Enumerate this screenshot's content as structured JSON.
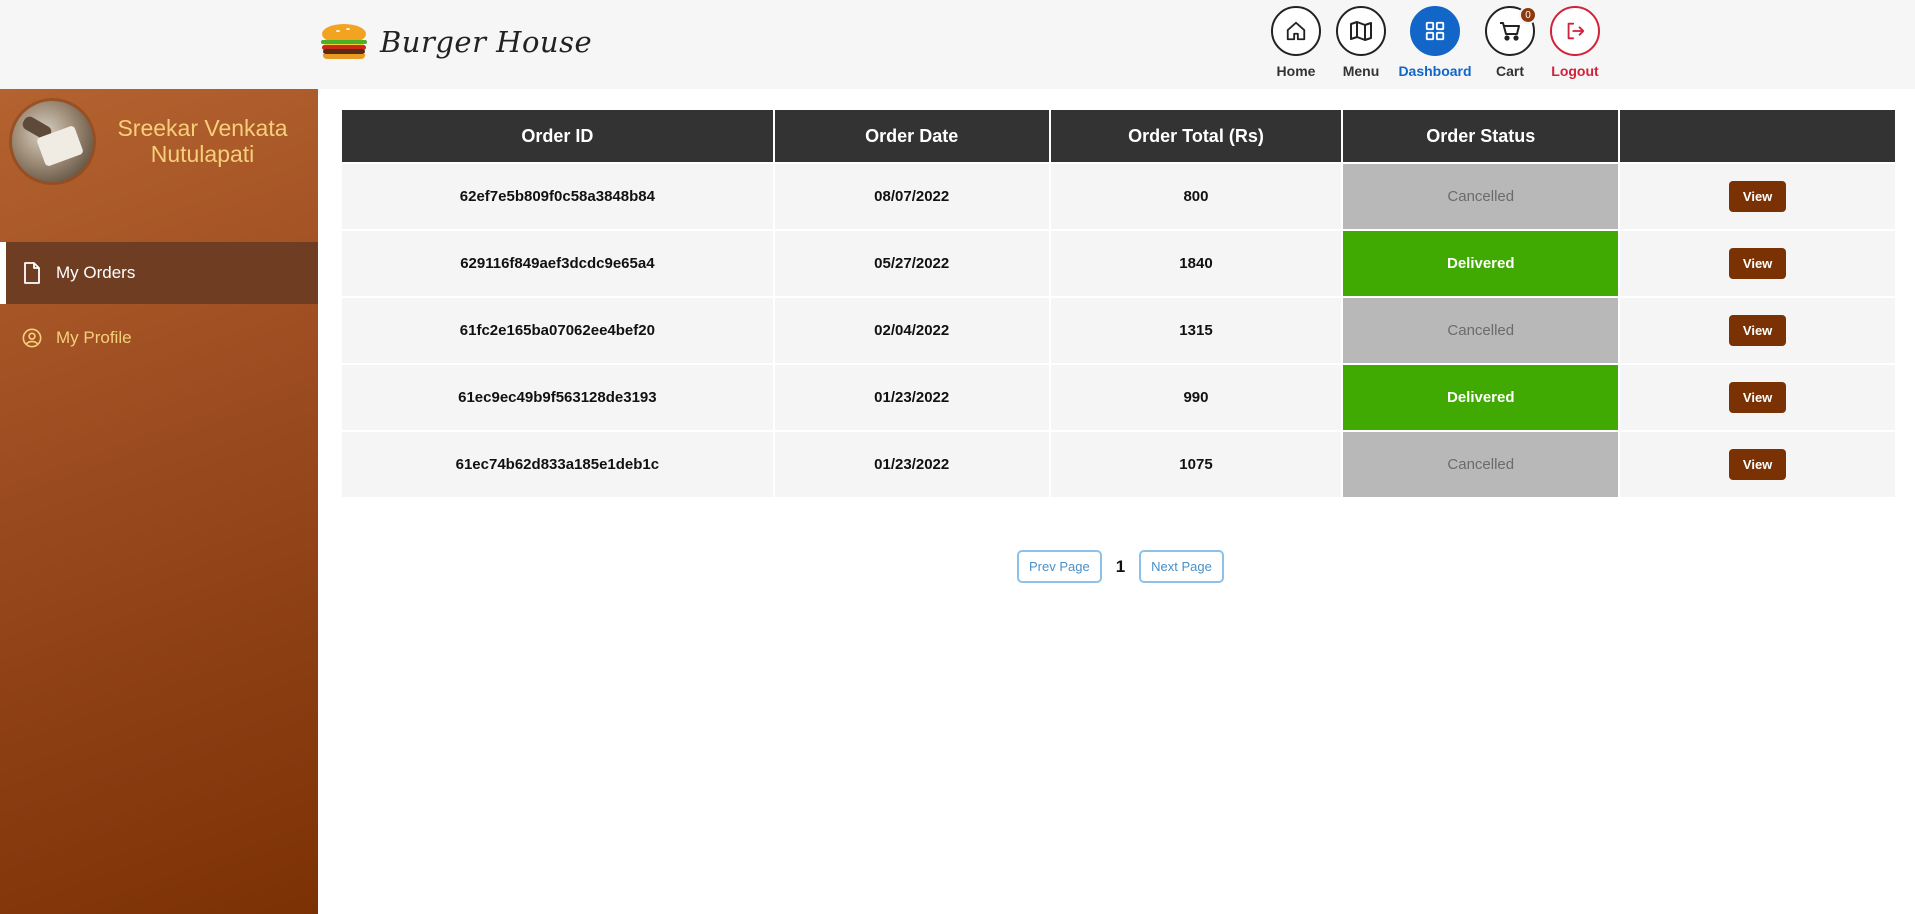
{
  "brand": {
    "name": "Burger House",
    "logo_icon": "burger-icon"
  },
  "nav": {
    "items": [
      {
        "label": "Home",
        "icon": "home-icon"
      },
      {
        "label": "Menu",
        "icon": "map-icon"
      },
      {
        "label": "Dashboard",
        "icon": "grid-icon"
      },
      {
        "label": "Cart",
        "icon": "cart-icon",
        "badge": "0"
      },
      {
        "label": "Logout",
        "icon": "logout-icon"
      }
    ],
    "active": "Dashboard"
  },
  "sidebar": {
    "user_name": "Sreekar Venkata Nutulapati",
    "items": [
      {
        "label": "My Orders",
        "icon": "document-icon"
      },
      {
        "label": "My Profile",
        "icon": "user-circle-icon"
      }
    ]
  },
  "table": {
    "headers": [
      "Order ID",
      "Order Date",
      "Order Total (Rs)",
      "Order Status",
      ""
    ],
    "rows": [
      {
        "id": "62ef7e5b809f0c58a3848b84",
        "date": "08/07/2022",
        "total": "800",
        "status": "Cancelled",
        "action": "View"
      },
      {
        "id": "629116f849aef3dcdc9e65a4",
        "date": "05/27/2022",
        "total": "1840",
        "status": "Delivered",
        "action": "View"
      },
      {
        "id": "61fc2e165ba07062ee4bef20",
        "date": "02/04/2022",
        "total": "1315",
        "status": "Cancelled",
        "action": "View"
      },
      {
        "id": "61ec9ec49b9f563128de3193",
        "date": "01/23/2022",
        "total": "990",
        "status": "Delivered",
        "action": "View"
      },
      {
        "id": "61ec74b62d833a185e1deb1c",
        "date": "01/23/2022",
        "total": "1075",
        "status": "Cancelled",
        "action": "View"
      }
    ]
  },
  "pagination": {
    "prev_label": "Prev Page",
    "current": "1",
    "next_label": "Next Page"
  },
  "colors": {
    "header_bg": "#f6f6f6",
    "sidebar_gradient_start": "#b4622f",
    "sidebar_gradient_end": "#7c3105",
    "accent_blue": "#1166c8",
    "logout_red": "#d0223a",
    "delivered_green": "#41aa02",
    "cancelled_gray": "#b8b8b8",
    "view_button": "#7a3204"
  }
}
